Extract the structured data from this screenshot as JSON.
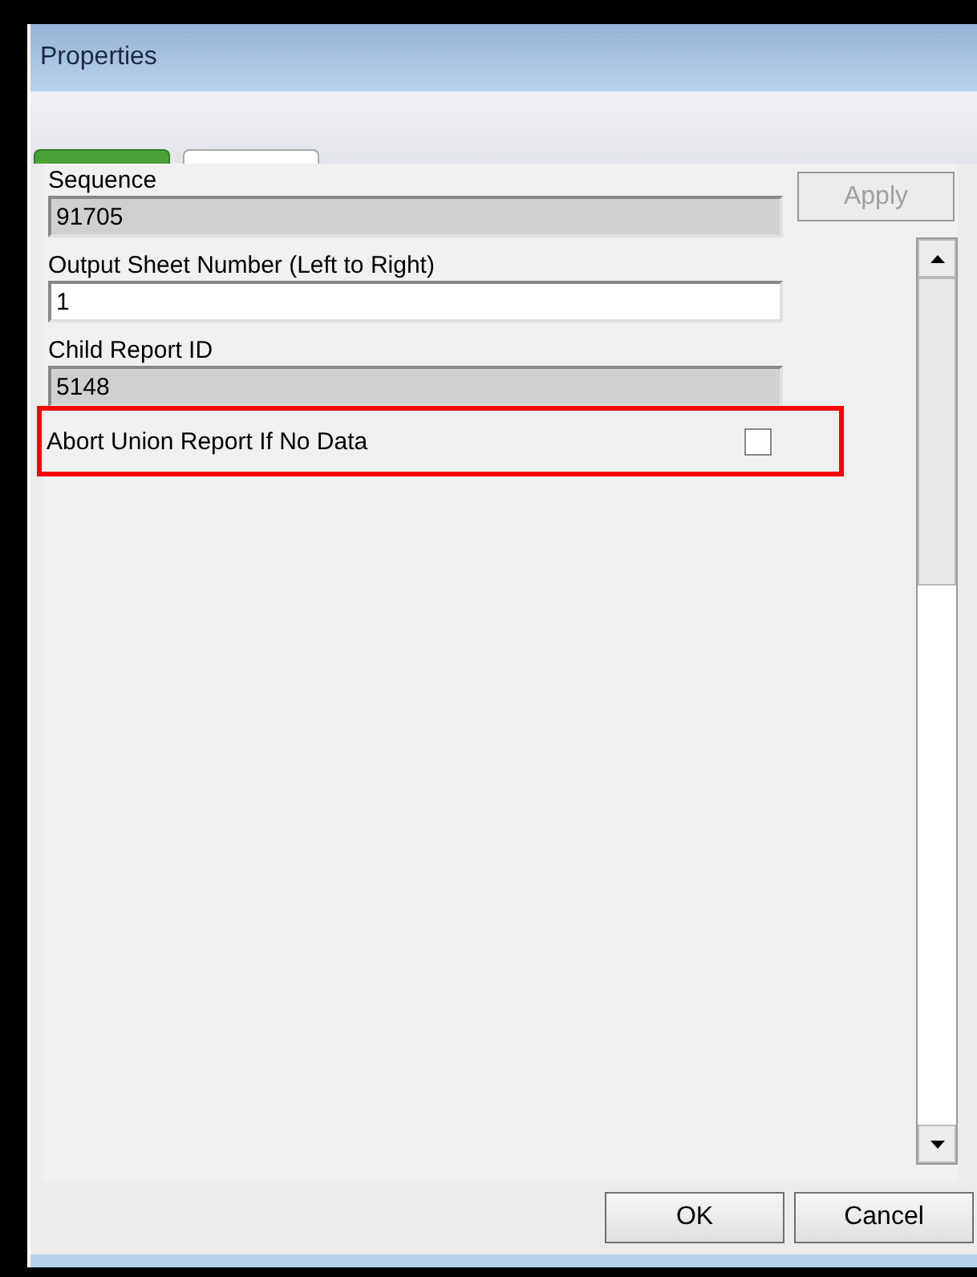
{
  "window": {
    "title": "Properties"
  },
  "tabs": [
    {
      "selected": true
    },
    {
      "selected": false
    }
  ],
  "apply_button": {
    "label": "Apply",
    "disabled": true
  },
  "fields": [
    {
      "label": "Sequence",
      "value": "91705",
      "readonly": true
    },
    {
      "label": "Output Sheet Number (Left to Right)",
      "value": "1",
      "readonly": false
    },
    {
      "label": "Child Report ID",
      "value": "5148",
      "readonly": true
    }
  ],
  "checkbox": {
    "label": "Abort Union Report If No Data",
    "checked": false,
    "highlighted": true
  },
  "buttons": [
    "OK",
    "Cancel"
  ]
}
